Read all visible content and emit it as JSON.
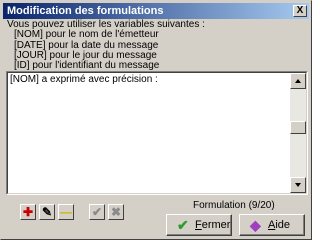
{
  "window": {
    "title": "Modification des formulations",
    "close_label": "X"
  },
  "info": {
    "intro": "Vous pouvez utiliser les variables suivantes :",
    "vars": [
      "[NOM] pour le nom de l'émetteur",
      "[DATE] pour la date du message",
      "[JOUR] pour le jour du message",
      "[ID] pour l'identifiant du message"
    ]
  },
  "editor": {
    "value": "[NOM] a exprimé avec précision :",
    "scroll_position": 0.41
  },
  "toolbar": {
    "add_icon": "plus-icon",
    "edit_icon": "edit-icon",
    "remove_icon": "minus-icon",
    "validate_icon": "check-icon",
    "cancel_icon": "cross-icon",
    "add_glyph": "✚",
    "edit_glyph": "✎",
    "remove_glyph": "—",
    "validate_glyph": "✔",
    "cancel_glyph": "✖"
  },
  "status": {
    "formulation": "Formulation (9/20)"
  },
  "buttons": {
    "close": {
      "label_first": "F",
      "label_rest": "ermer",
      "icon": "check-icon",
      "glyph": "✔"
    },
    "help": {
      "label_first": "A",
      "label_rest": "ide",
      "icon": "book-icon",
      "glyph": "◆"
    }
  },
  "colors": {
    "titlebar_start": "#0a246a",
    "titlebar_end": "#a6caf0",
    "add": "#cc0000",
    "remove": "#c8b400",
    "validate_disabled": "#8a8a8a",
    "ok": "#2e9b2e",
    "help": "#a040c0"
  }
}
